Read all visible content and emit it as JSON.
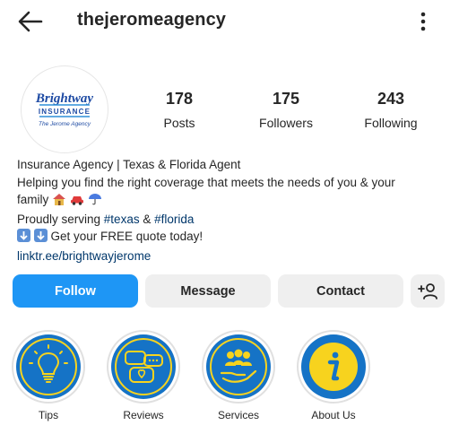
{
  "header": {
    "username": "thejeromeagency",
    "back_icon": "arrow-left-icon",
    "more_icon": "kebab-menu-icon"
  },
  "profile": {
    "logo": {
      "brand": "Brightway",
      "sub": "INSURANCE",
      "agency": "The Jerome Agency",
      "colors": {
        "blue": "#1d4aa3",
        "light_blue": "#2f8fd8"
      }
    },
    "stats": [
      {
        "value": "178",
        "label": "Posts"
      },
      {
        "value": "175",
        "label": "Followers"
      },
      {
        "value": "243",
        "label": "Following"
      }
    ]
  },
  "bio": {
    "name": "Insurance Agency | Texas & Florida Agent",
    "line1": "Helping you find the right coverage that meets the needs of you & your",
    "line2": "family",
    "line3_prefix": "Proudly serving ",
    "tag1": "#texas",
    "line3_mid": " & ",
    "tag2": "#florida",
    "line4": " Get your FREE quote today!",
    "link": "linktr.ee/brightwayjerome"
  },
  "actions": {
    "follow": "Follow",
    "message": "Message",
    "contact": "Contact",
    "add_icon": "add-person-icon"
  },
  "highlights": [
    {
      "label": "Tips",
      "icon": "lightbulb-icon"
    },
    {
      "label": "Reviews",
      "icon": "chat-bubbles-icon"
    },
    {
      "label": "Services",
      "icon": "people-hand-icon"
    },
    {
      "label": "About Us",
      "icon": "info-icon"
    }
  ],
  "colors": {
    "accent": "#1e96f5",
    "link": "#00376b",
    "highlight_blue": "#1573c6",
    "highlight_yellow": "#f7d31e"
  }
}
